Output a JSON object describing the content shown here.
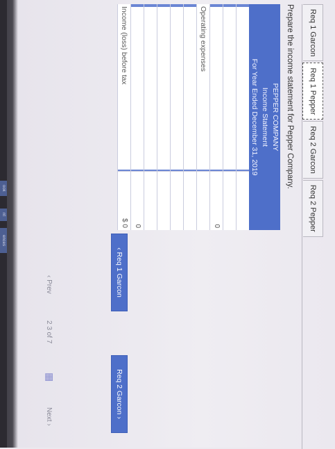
{
  "sidebar": {
    "items": [
      {
        "label": "ook"
      },
      {
        "label": "nt"
      },
      {
        "label": "ences"
      }
    ]
  },
  "tabs": [
    {
      "label": "Req 1 Garcon"
    },
    {
      "label": "Req 1 Pepper"
    },
    {
      "label": "Req 2 Garcon"
    },
    {
      "label": "Req 2 Pepper"
    }
  ],
  "instruction": "Prepare the income statement for Pepper Company.",
  "statement": {
    "company": "PEPPER COMPANY",
    "title": "Income Statement",
    "period": "For Year Ended December 31, 2019",
    "rows": [
      {
        "label": "",
        "value": ""
      },
      {
        "label": "",
        "value": ""
      },
      {
        "label": "",
        "value": "0"
      },
      {
        "label": "Operating expenses",
        "value": ""
      },
      {
        "label": "",
        "value": ""
      },
      {
        "label": "",
        "value": ""
      },
      {
        "label": "",
        "value": ""
      },
      {
        "label": "",
        "value": ""
      },
      {
        "label": "",
        "value": "0"
      },
      {
        "label": "Income (loss) before tax",
        "value": "$ 0"
      }
    ]
  },
  "nav": {
    "prev_req": "Req 1 Garcon",
    "next_req": "Req 2 Garcon",
    "prev": "Prev",
    "page": "2 3 of 7",
    "next": "Next"
  }
}
